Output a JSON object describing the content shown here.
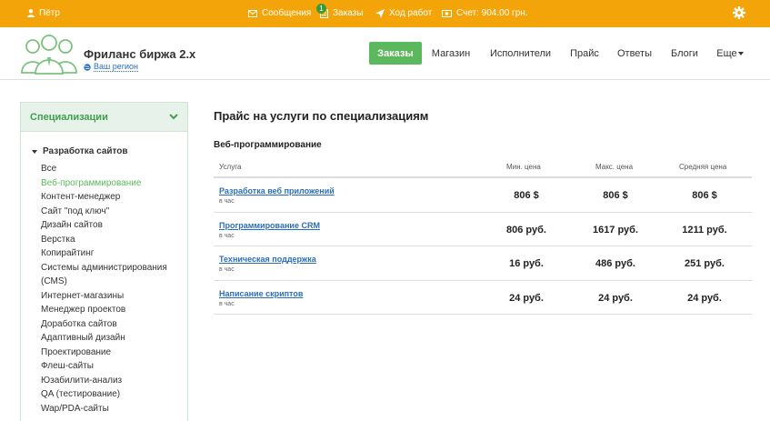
{
  "topbar": {
    "user_name": "Пётр",
    "messages_label": "Сообщения",
    "orders_label": "Заказы",
    "orders_badge": "1",
    "progress_label": "Ход работ",
    "balance_label": "Счет: 904.00 грн."
  },
  "header": {
    "brand_title": "Фриланс биржа 2.x",
    "region_link": "Ваш регион",
    "nav": [
      {
        "label": "Заказы"
      },
      {
        "label": "Магазин"
      },
      {
        "label": "Исполнители"
      },
      {
        "label": "Прайс"
      },
      {
        "label": "Ответы"
      },
      {
        "label": "Блоги"
      },
      {
        "label": "Еще"
      }
    ]
  },
  "sidebar": {
    "heading": "Специализации",
    "category": "Разработка сайтов",
    "items": [
      "Все",
      "Веб-программирование",
      "Контент-менеджер",
      "Сайт \"под ключ\"",
      "Дизайн сайтов",
      "Верстка",
      "Копирайтинг",
      "Системы администрирования",
      "(CMS)",
      "Интернет-магазины",
      "Менеджер проектов",
      "Доработка сайтов",
      "Адаптивный дизайн",
      "Проектирование",
      "Флеш-сайты",
      "Юзабилити-анализ",
      "QA (тестирование)",
      "Wap/PDA-сайты"
    ]
  },
  "main": {
    "title": "Прайс на услуги по специализациям",
    "section": "Веб-программирование",
    "columns": {
      "service": "Услуга",
      "min": "Мин. цена",
      "max": "Макс. цена",
      "avg": "Средняя цена"
    },
    "rows": [
      {
        "service": "Разработка веб приложений",
        "unit": "в час",
        "min": "806 $",
        "max": "806 $",
        "avg": "806 $"
      },
      {
        "service": "Программирование CRM",
        "unit": "в час",
        "min": "806 руб.",
        "max": "1617 руб.",
        "avg": "1211 руб."
      },
      {
        "service": "Техническая поддержка",
        "unit": "в час",
        "min": "16 руб.",
        "max": "486 руб.",
        "avg": "251 руб."
      },
      {
        "service": "Написание скриптов",
        "unit": "в час",
        "min": "24 руб.",
        "max": "24 руб.",
        "avg": "24 руб."
      }
    ]
  },
  "colors": {
    "topbar": "#f3a408",
    "accent_green": "#5cb85c",
    "link_blue": "#2a6ebb"
  },
  "icons": {
    "user": "user-icon",
    "messages": "envelope-icon",
    "orders": "clipboard-icon",
    "progress": "paper-plane-icon",
    "balance": "money-icon",
    "settings": "gear-icon",
    "region": "globe-icon"
  }
}
